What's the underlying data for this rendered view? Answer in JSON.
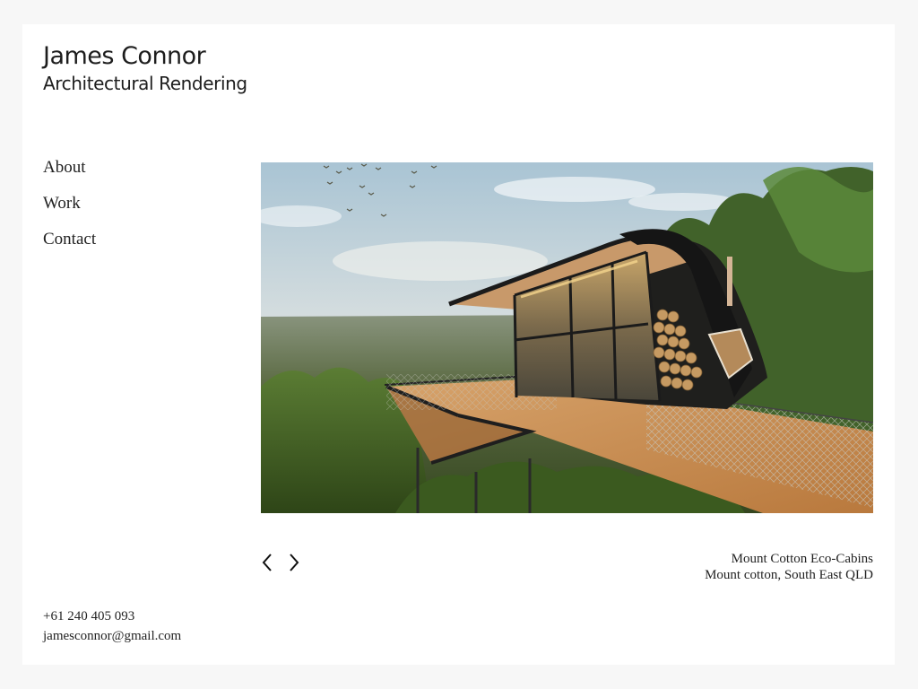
{
  "header": {
    "name": "James Connor",
    "subtitle": "Architectural Rendering"
  },
  "nav": {
    "items": [
      {
        "label": "About"
      },
      {
        "label": "Work"
      },
      {
        "label": "Contact"
      }
    ]
  },
  "gallery": {
    "image_icon": "eco-cabin-rendering",
    "prev_icon": "chevron-left-icon",
    "next_icon": "chevron-right-icon",
    "caption_title": "Mount Cotton Eco-Cabins",
    "caption_location": "Mount cotton, South East QLD"
  },
  "contact": {
    "phone": "+61 240 405 093",
    "email": "jamesconnor@gmail.com"
  },
  "colors": {
    "page_bg": "#f7f7f7",
    "card_bg": "#ffffff",
    "text": "#1d1d1d"
  }
}
